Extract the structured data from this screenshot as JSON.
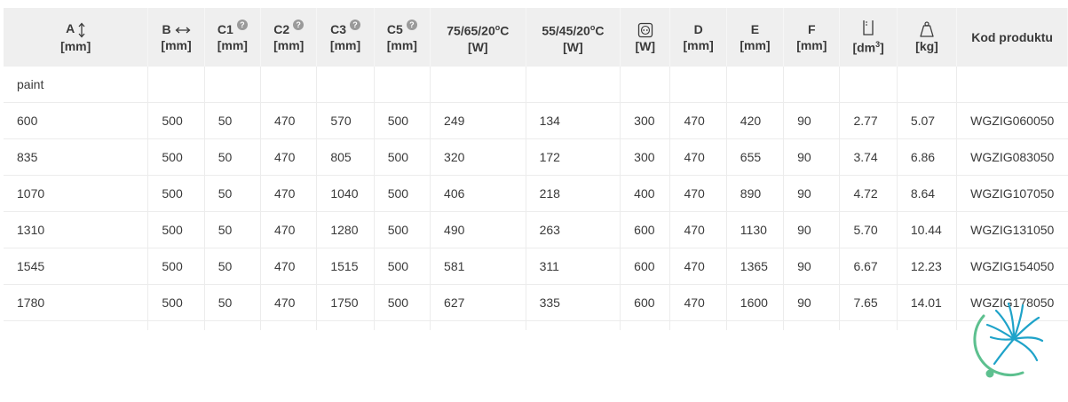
{
  "table": {
    "headers": [
      {
        "name": "A",
        "unit": "[mm]",
        "icon": "vertical-arrow-icon"
      },
      {
        "name": "B",
        "unit": "[mm]",
        "icon": "horizontal-arrow-icon"
      },
      {
        "name": "C1",
        "unit": "[mm]",
        "icon": "help-icon"
      },
      {
        "name": "C2",
        "unit": "[mm]",
        "icon": "help-icon"
      },
      {
        "name": "C3",
        "unit": "[mm]",
        "icon": "help-icon"
      },
      {
        "name": "C5",
        "unit": "[mm]",
        "icon": "help-icon"
      },
      {
        "name": "75/65/20",
        "sup": "o",
        "suffix": "C",
        "unit": "[W]"
      },
      {
        "name": "55/45/20",
        "sup": "o",
        "suffix": "C",
        "unit": "[W]"
      },
      {
        "name": "",
        "unit": "[W]",
        "icon": "power-socket-icon"
      },
      {
        "name": "D",
        "unit": "[mm]"
      },
      {
        "name": "E",
        "unit": "[mm]"
      },
      {
        "name": "F",
        "unit": "[mm]"
      },
      {
        "name": "",
        "unit_pre": "[dm",
        "unit_sup": "3",
        "unit_post": "]",
        "icon": "volume-container-icon"
      },
      {
        "name": "",
        "unit": "[kg]",
        "icon": "weight-icon"
      },
      {
        "name": "Kod produktu",
        "unit": ""
      }
    ],
    "rows": [
      [
        "paint",
        "",
        "",
        "",
        "",
        "",
        "",
        "",
        "",
        "",
        "",
        "",
        "",
        "",
        ""
      ],
      [
        "600",
        "500",
        "50",
        "470",
        "570",
        "500",
        "249",
        "134",
        "300",
        "470",
        "420",
        "90",
        "2.77",
        "5.07",
        "WGZIG060050"
      ],
      [
        "835",
        "500",
        "50",
        "470",
        "805",
        "500",
        "320",
        "172",
        "300",
        "470",
        "655",
        "90",
        "3.74",
        "6.86",
        "WGZIG083050"
      ],
      [
        "1070",
        "500",
        "50",
        "470",
        "1040",
        "500",
        "406",
        "218",
        "400",
        "470",
        "890",
        "90",
        "4.72",
        "8.64",
        "WGZIG107050"
      ],
      [
        "1310",
        "500",
        "50",
        "470",
        "1280",
        "500",
        "490",
        "263",
        "600",
        "470",
        "1130",
        "90",
        "5.70",
        "10.44",
        "WGZIG131050"
      ],
      [
        "1545",
        "500",
        "50",
        "470",
        "1515",
        "500",
        "581",
        "311",
        "600",
        "470",
        "1365",
        "90",
        "6.67",
        "12.23",
        "WGZIG154050"
      ],
      [
        "1780",
        "500",
        "50",
        "470",
        "1750",
        "500",
        "627",
        "335",
        "600",
        "470",
        "1600",
        "90",
        "7.65",
        "14.01",
        "WGZIG178050"
      ]
    ]
  },
  "help_glyph": "?",
  "colors": {
    "header_bg": "#efefef",
    "text": "#3a3a3a",
    "row_border": "#ececec",
    "help_icon": "#9a9a9a",
    "logo_blue": "#1fa3c9",
    "logo_green": "#5dc08f"
  }
}
